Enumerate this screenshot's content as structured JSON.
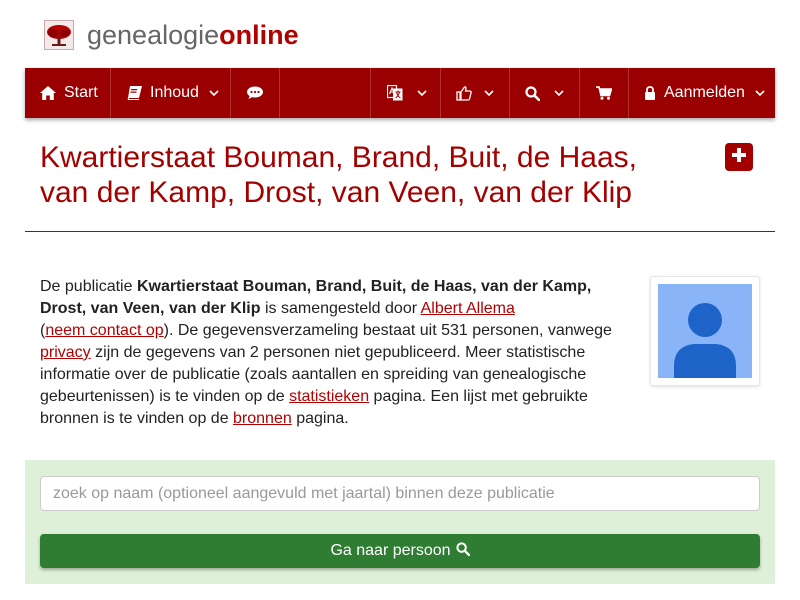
{
  "brand": {
    "part1": "genealogie",
    "part2": "online"
  },
  "nav": {
    "start_label": "Start",
    "inhoud_label": "Inhoud",
    "login_label": "Aanmelden"
  },
  "icons": [
    "home-icon",
    "book-icon",
    "comments-icon",
    "language-icon",
    "thumbs-up-icon",
    "search-icon",
    "cart-icon",
    "lock-icon",
    "chevron-down-icon",
    "plus-square-icon",
    "person-placeholder-icon"
  ],
  "colors": {
    "accent": "#9b0000",
    "title": "#a30000",
    "panel": "#def0d8",
    "button": "#2e7d32",
    "avatar_bg": "#8ab4f8"
  },
  "title": {
    "line1": "Kwartierstaat Bouman, Brand, Buit, de Haas,",
    "line2": "van der Kamp, Drost, van Veen, van der Klip"
  },
  "description": {
    "t1": "De publicatie ",
    "pub_name": "Kwartierstaat Bouman, Brand, Buit, de Haas, van der Kamp, Drost, van Veen, van der Klip",
    "t2": " is samengesteld door ",
    "author_link": "Albert Allema",
    "t3": "(",
    "contact_link": "neem contact op",
    "t4": "). De gegevensverzameling bestaat uit 531 personen, vanwege ",
    "privacy_link": "privacy",
    "t5": " zijn de gegevens van 2 personen niet gepubliceerd. Meer statistische informatie over de publicatie (zoals aantallen en spreiding van genealogische gebeurtenissen) is te vinden op de ",
    "stats_link": "statistieken",
    "t6": " pagina. Een lijst met gebruikte bronnen is te vinden op de ",
    "sources_link": "bronnen",
    "t7": " pagina."
  },
  "search": {
    "placeholder": "zoek op naam (optioneel aangevuld met jaartal) binnen deze publicatie",
    "button_label": "Ga naar persoon"
  }
}
